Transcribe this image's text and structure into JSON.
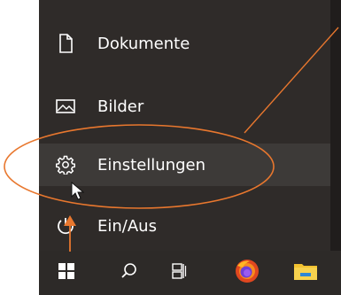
{
  "start_menu": {
    "items": [
      {
        "label": "Dokumente",
        "icon": "document-icon"
      },
      {
        "label": "Bilder",
        "icon": "pictures-icon"
      },
      {
        "label": "Einstellungen",
        "icon": "gear-icon"
      },
      {
        "label": "Ein/Aus",
        "icon": "power-icon"
      }
    ]
  },
  "taskbar": {
    "buttons": [
      {
        "icon": "windows-start-icon"
      },
      {
        "icon": "search-icon"
      },
      {
        "icon": "task-view-icon"
      },
      {
        "icon": "firefox-icon"
      },
      {
        "icon": "file-explorer-icon"
      }
    ]
  },
  "colors": {
    "menu_bg": "#2f2b29",
    "taskbar_bg": "#2d2a28",
    "annotation": "#e8772e"
  }
}
